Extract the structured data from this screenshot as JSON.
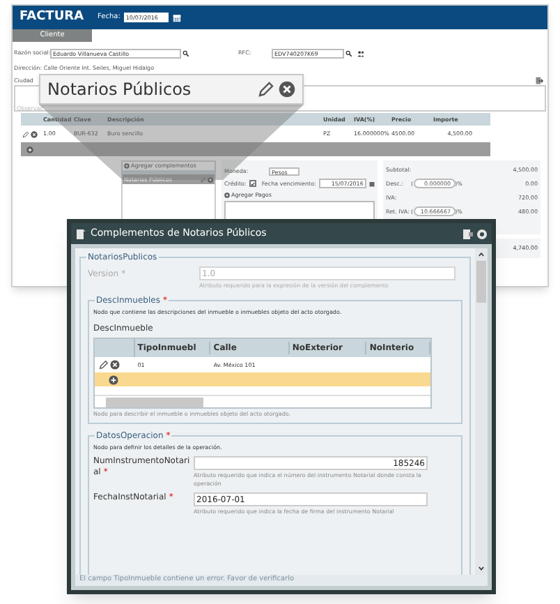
{
  "invoice": {
    "title": "FACTURA",
    "date_label": "Fecha:",
    "date": "10/07/2016",
    "tabs": [
      {
        "label": "Cliente",
        "selected": true
      }
    ],
    "razon_social_label": "Razón social:",
    "razon_social": "Eduardo Villanueva Castillo",
    "rfc_label": "RFC:",
    "rfc": "EDV740207K69",
    "address": "Dirección: Calle Oriente Int. Seiles, Miguel Hidalgo",
    "city_label": "Ciudad",
    "observations_placeholder": "Observac",
    "items_table": {
      "columns": [
        "Cantidad",
        "Clave",
        "Descripción",
        "Unidad",
        "IVA(%)",
        "Precio",
        "Importe"
      ],
      "rows": [
        [
          "1.00",
          "BUR-632",
          "Buro sencillo",
          "PZ",
          "16.000000%",
          "4500.00",
          "4,500.00"
        ]
      ]
    },
    "complements": {
      "button": "Agregar complementos",
      "items": [
        {
          "label": "Notarios Públicos"
        }
      ]
    },
    "payment": {
      "currency_label": "Moneda:",
      "currency": "Pesos",
      "credit_label": "Crédito:",
      "credit": true,
      "due_label": "Fecha vencimiento:",
      "due_date": "15/07/2016",
      "add_payments": "Agregar Pagos"
    },
    "totals": [
      {
        "label": "Subtotal:",
        "amount": "4,500.00"
      },
      {
        "label": "Desc.:",
        "rate_open": "(",
        "rate": "0.000000",
        "rate_close": ")%",
        "amount": "0.00"
      },
      {
        "label": "IVA:",
        "amount": "720.00"
      },
      {
        "label": "Ret. IVA:",
        "rate_open": "(",
        "rate": "10.666667",
        "rate_close": ")%",
        "amount": "480.00"
      }
    ],
    "total": "4,740.00"
  },
  "callout": {
    "title": "Notarios Públicos"
  },
  "dialog": {
    "title": "Complementos de Notarios Públicos",
    "section": {
      "legend": "NotariosPublicos",
      "version_label": "Version",
      "required_mark": "*",
      "version": "1.0",
      "version_hint": "Atributo requerido para la expresión de la versión del complemento",
      "desc_inmuebles": {
        "legend": "DescInmuebles",
        "required_mark": "*",
        "description": "Nodo que contiene las descripciones del inmueble o inmuebles objeto del acto otorgado.",
        "heading": "DescInmueble",
        "columns": [
          "TipoInmuebl",
          "Calle",
          "NoExterior",
          "NoInterio"
        ],
        "rows": [
          [
            "01",
            "Av. México 101",
            "",
            ""
          ]
        ],
        "hint": "Nodo para describir el inmueble o inmuebles objeto del acto otorgado."
      },
      "datos_operacion": {
        "legend": "DatosOperacion",
        "required_mark": "*",
        "description": "Nodo para definir los detalles de la operación.",
        "fields": [
          {
            "label": "NumInstrumentoNotarial",
            "required_mark": "*",
            "value": "185246",
            "kind": "number",
            "hint": "Atributo requerido que indica el número del instrumento Notarial donde consta la operación"
          },
          {
            "label": "FechaInstNotarial",
            "required_mark": "*",
            "value": "2016-07-01",
            "kind": "date",
            "hint": "Atributo requerido que indica la fecha de firma del instrumento Notarial"
          }
        ]
      }
    },
    "status": "El campo TipoInmueble contiene un error. Favor de verificarlo"
  }
}
